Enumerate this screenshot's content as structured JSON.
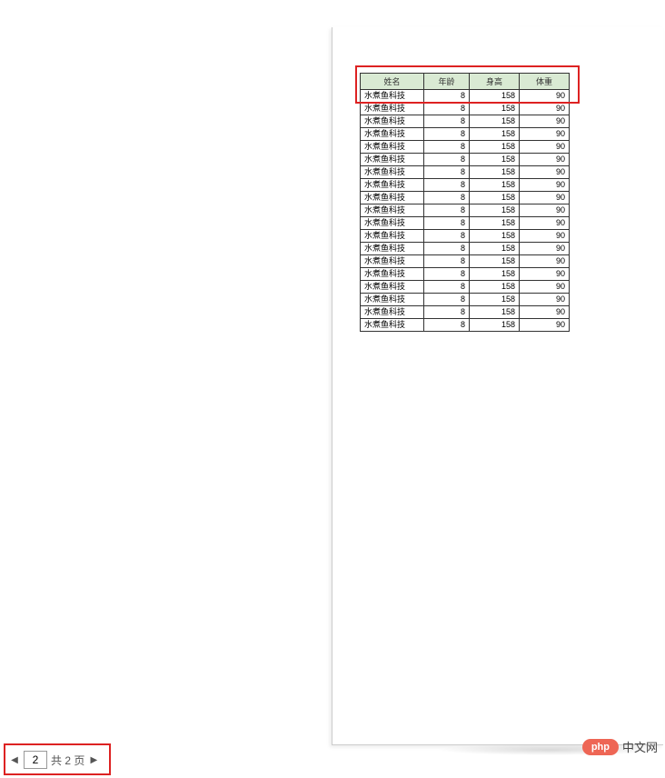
{
  "table": {
    "headers": [
      "姓名",
      "年龄",
      "身高",
      "体重"
    ],
    "row": {
      "name": "水煮鱼科技",
      "age": "8",
      "height": "158",
      "weight": "90"
    },
    "rowCount": 19
  },
  "pager": {
    "current": "2",
    "total_label": "共 2 页"
  },
  "watermark": {
    "badge": "php",
    "text": "中文网"
  }
}
